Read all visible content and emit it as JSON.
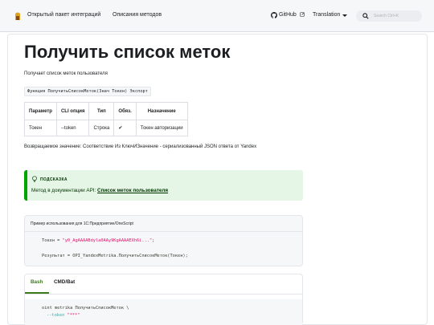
{
  "navbar": {
    "brand": "Открытый пакет интеграций",
    "links": [
      "Описания методов"
    ],
    "github_label": "GitHub",
    "translation_label": "Translation",
    "search_placeholder": "Search Ctrl+K"
  },
  "page": {
    "title": "Получить список меток",
    "subtitle": "Получает список меток пользователя",
    "signature": "Функция ПолучитьСписокМеток(Знач Токен) Экспорт"
  },
  "params_table": {
    "headers": [
      "Параметр",
      "CLI опция",
      "Тип",
      "Обяз.",
      "Назначение"
    ],
    "rows": [
      [
        "Токен",
        "--token",
        "Строка",
        "✔",
        "Токен авторизации"
      ]
    ]
  },
  "return_value": "Возвращаемое значение: Соответствие Из КлючИЗначение - сериализованный JSON ответа от Yandex",
  "tip": {
    "heading": "ПОДСКАЗКА",
    "text_prefix": "Метод в документации API: ",
    "link_text": "Список меток пользователя"
  },
  "example": {
    "title": "Пример использования для 1С:Предприятие/OneScript",
    "line1_var": "Токен = ",
    "line1_str": "\"y0_AgAAAABdyla0AAy9KgAAAAEXh6i...\"",
    "line1_end": ";",
    "line2": "Результат = OPI_YandexMetrika.ПолучитьСписокМеток(Токен);"
  },
  "cli": {
    "tabs": [
      "Bash",
      "CMD/Bat"
    ],
    "active_tab": "Bash",
    "line1": "oint metrika ПолучитьСписокМеток \\",
    "line2_flag": "--token",
    "line2_val": "\"***\""
  },
  "colors": {
    "accent": "#3c7a1d",
    "tip_bg": "#e6f6e6",
    "tip_border": "#00a400",
    "code_string": "#e3116c"
  }
}
